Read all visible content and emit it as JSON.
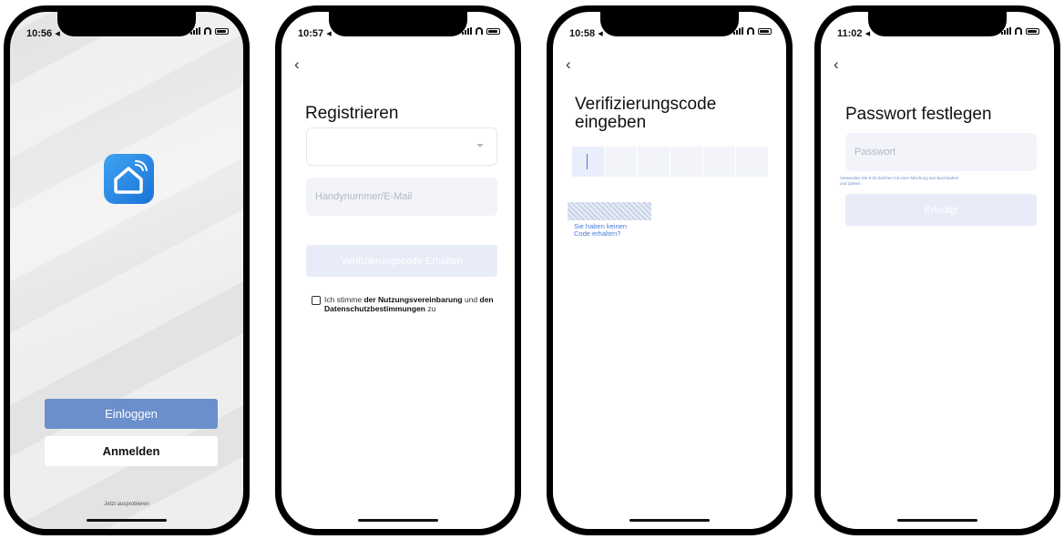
{
  "phone1": {
    "status": {
      "time": "10:56 ◂"
    },
    "buttons": {
      "login": "Einloggen",
      "register": "Anmelden"
    },
    "try_link": "Jetzt ausprobieren"
  },
  "phone2": {
    "status": {
      "time": "10:57 ◂"
    },
    "title": "Registrieren",
    "country_select": "",
    "contact_placeholder": "Handynummer/E-Mail",
    "get_code_button": "Verifizierungscode Erhalten",
    "consent": {
      "prefix": "Ich stimme ",
      "terms": "der Nutzungsvereinbarung",
      "middle": " und ",
      "privacy": "den Datenschutzbestimmungen",
      "suffix": " zu"
    }
  },
  "phone3": {
    "status": {
      "time": "10:58 ◂"
    },
    "title_line1": "Verifizierungscode",
    "title_line2": "eingeben",
    "code_digits": [
      "",
      "",
      "",
      "",
      "",
      ""
    ],
    "resend_line1": "Sie haben keinen",
    "resend_line2": "Code erhalten?"
  },
  "phone4": {
    "status": {
      "time": "11:02 ◂"
    },
    "title": "Passwort festlegen",
    "password_placeholder": "Passwort",
    "hint_line1": "Verwenden Sie 6-20 Zeichen mit einer Mischung aus Buchstaben",
    "hint_line2": "und Zahlen",
    "done_button": "Erledigt"
  },
  "colors": {
    "primary": "#6b8fcc",
    "disabled": "#e8ebf8",
    "input_bg": "#f2f4fa",
    "link": "#4a7bd9",
    "icon_gradient_start": "#3fa3f0",
    "icon_gradient_end": "#1a73d8"
  },
  "icons": [
    "signal-icon",
    "wifi-icon",
    "battery-icon",
    "back-chevron-icon",
    "smart-home-app-icon",
    "dropdown-chevron-icon",
    "checkbox-icon"
  ]
}
